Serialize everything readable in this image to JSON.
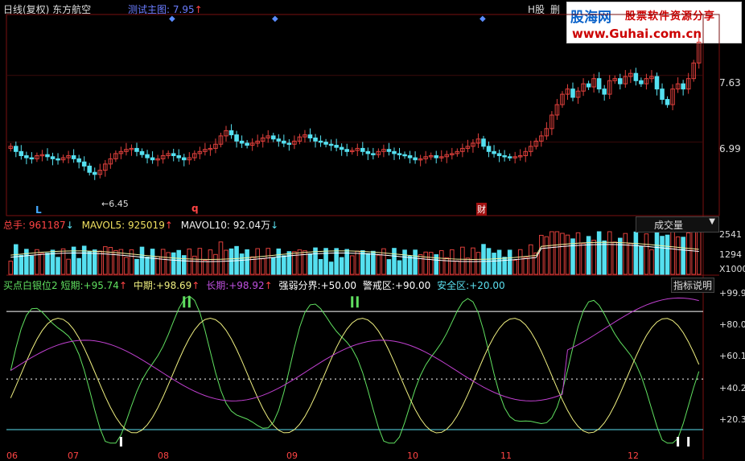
{
  "colors": {
    "bg": "#000000",
    "up": "#e0403c",
    "down": "#55e0f0",
    "grid": "#6a1010",
    "white": "#ffffff",
    "yellow": "#f0f080",
    "magenta": "#c040d0",
    "green": "#60e060"
  },
  "header": {
    "title": "日线(复权) 东方航空",
    "test": "测试主图:",
    "test_val": "7.95",
    "test_arrow": "↑",
    "hstock": "H股",
    "del": "删"
  },
  "watermark": {
    "brand": "股海网",
    "slogan": "股票软件资源分享",
    "url": "www.Guhai.com.cn"
  },
  "price_axis": [
    "7.63",
    "6.99"
  ],
  "markers": {
    "low_label": "6.45",
    "L": "L",
    "q": "q",
    "cai": "财"
  },
  "volume": {
    "label": "总手:",
    "value": "961187",
    "arrow1": "↓",
    "mavol5_label": "MAVOL5:",
    "mavol5": "925019",
    "arrow2": "↑",
    "mavol10_label": "MAVOL10:",
    "mavol10": "92.04万",
    "arrow3": "↓",
    "dropdown": "成交量",
    "axis": [
      "2541",
      "1294",
      "X1000"
    ]
  },
  "indicator": {
    "name": "买点白银位2",
    "short_label": "短期:",
    "short_val": "+95.74",
    "short_arrow": "↑",
    "mid_label": "中期:",
    "mid_val": "+98.69",
    "mid_arrow": "↑",
    "long_label": "长期:",
    "long_val": "+98.92",
    "long_arrow": "↑",
    "strong": "强弱分界:",
    "strong_val": "+50.00",
    "warn": "警戒区:",
    "warn_val": "+90.00",
    "safe": "安全区:",
    "safe_val": "+20.00",
    "help": "指标说明",
    "axis": [
      "+99.9",
      "+80.0",
      "+60.1",
      "+40.2",
      "+20.3"
    ]
  },
  "x_labels": [
    "06",
    "07",
    "08",
    "09",
    "10",
    "11",
    "12"
  ],
  "chart_data": {
    "type": "candlestick",
    "panes": [
      "price",
      "volume",
      "indicator"
    ],
    "price_ylim": [
      6.3,
      8.2
    ],
    "closes": [
      6.95,
      6.9,
      6.86,
      6.84,
      6.83,
      6.86,
      6.87,
      6.85,
      6.83,
      6.82,
      6.84,
      6.86,
      6.83,
      6.8,
      6.76,
      6.7,
      6.68,
      6.72,
      6.78,
      6.83,
      6.88,
      6.9,
      6.92,
      6.93,
      6.9,
      6.87,
      6.84,
      6.82,
      6.83,
      6.86,
      6.88,
      6.86,
      6.84,
      6.82,
      6.84,
      6.88,
      6.9,
      6.92,
      6.93,
      6.97,
      7.05,
      7.1,
      7.06,
      7.0,
      6.98,
      6.96,
      6.98,
      7.0,
      7.03,
      7.05,
      7.02,
      7.0,
      6.98,
      6.97,
      7.0,
      7.04,
      7.06,
      7.03,
      7.0,
      6.99,
      6.97,
      6.96,
      6.94,
      6.92,
      6.9,
      6.91,
      6.93,
      6.9,
      6.88,
      6.87,
      6.9,
      6.92,
      6.9,
      6.88,
      6.87,
      6.86,
      6.84,
      6.82,
      6.83,
      6.85,
      6.86,
      6.84,
      6.85,
      6.87,
      6.88,
      6.9,
      6.93,
      6.95,
      6.98,
      7.02,
      6.95,
      6.9,
      6.88,
      6.86,
      6.85,
      6.84,
      6.85,
      6.86,
      6.9,
      6.95,
      7.0,
      7.05,
      7.12,
      7.25,
      7.35,
      7.45,
      7.5,
      7.42,
      7.48,
      7.55,
      7.52,
      7.6,
      7.5,
      7.45,
      7.58,
      7.6,
      7.55,
      7.62,
      7.65,
      7.58,
      7.55,
      7.6,
      7.62,
      7.5,
      7.4,
      7.35,
      7.5,
      7.55,
      7.5,
      7.6,
      7.75,
      7.95
    ]
  }
}
